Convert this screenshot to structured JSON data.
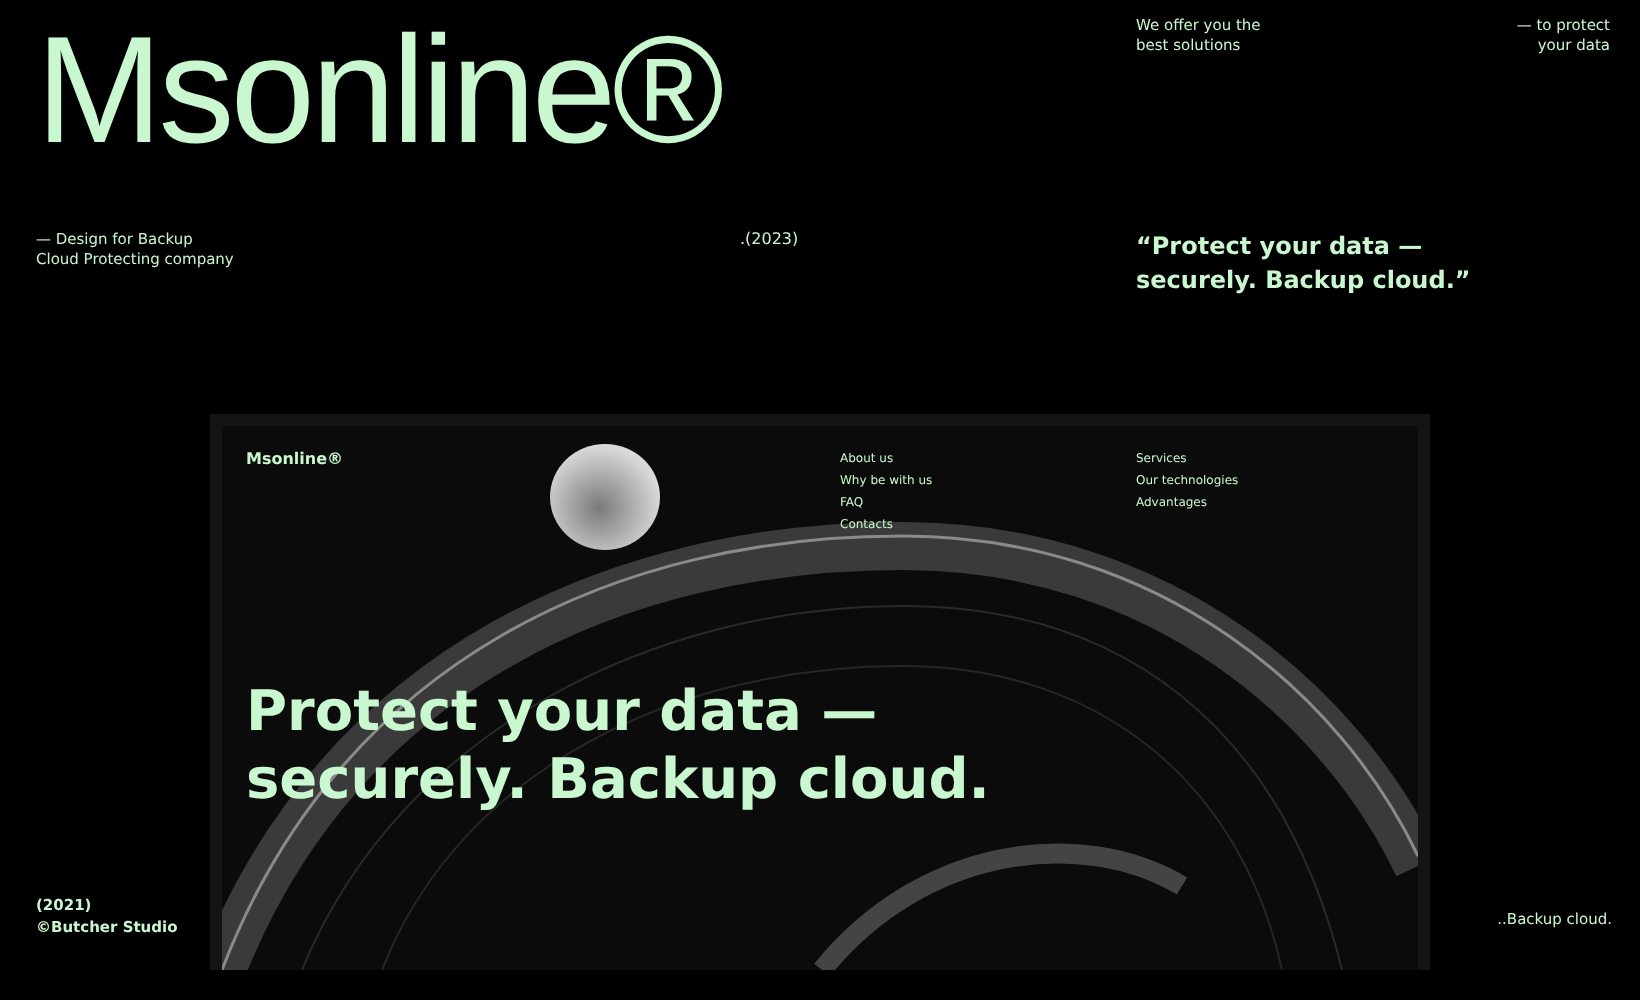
{
  "logo": "Msonline®",
  "offer": [
    "We offer you the",
    "best solutions"
  ],
  "protect_note": [
    "— to protect",
    "your data"
  ],
  "description": [
    "— Design for Backup",
    "Cloud Protecting company"
  ],
  "year": ".(2023)",
  "quote": [
    "“Protect your data —",
    "securely. Backup cloud.”"
  ],
  "mockup": {
    "logo": "Msonline®",
    "nav_primary": [
      "About us",
      "Why be with us",
      "FAQ",
      "Contacts"
    ],
    "nav_secondary": [
      "Services",
      "Our technologies",
      "Advantages"
    ],
    "headline": [
      "Protect your data —",
      "securely. Backup cloud."
    ]
  },
  "footer": {
    "year": "(2021)",
    "credit": "©Butcher Studio",
    "tagline": "..Backup cloud."
  }
}
